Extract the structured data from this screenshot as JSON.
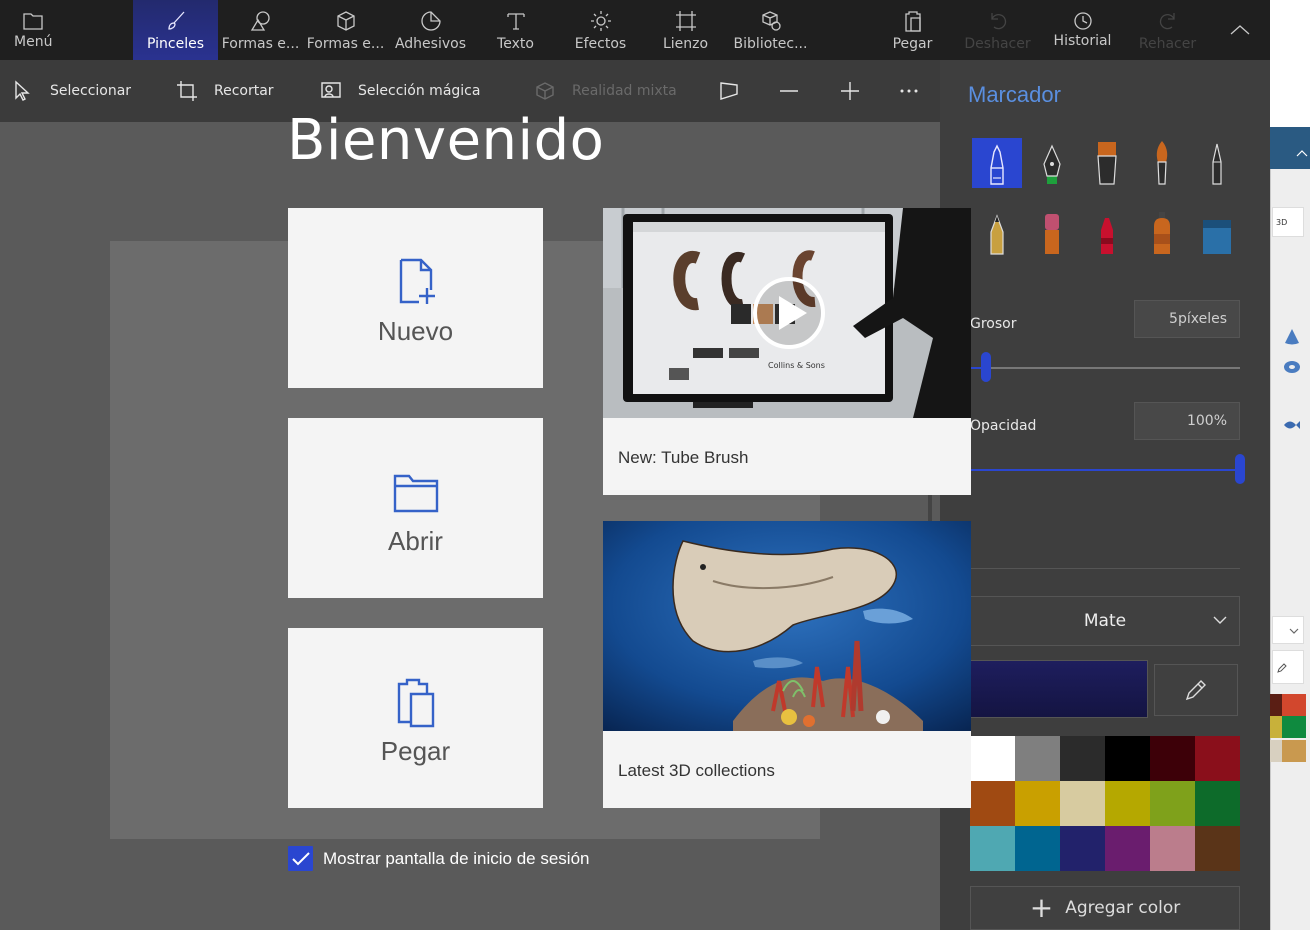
{
  "ribbon": {
    "menu": "Menú",
    "brushes": "Pinceles",
    "shapes2d": "Formas e...",
    "shapes3d": "Formas e...",
    "stickers": "Adhesivos",
    "text": "Texto",
    "effects": "Efectos",
    "canvas": "Lienzo",
    "library": "Bibliotec...",
    "paste": "Pegar",
    "undo": "Deshacer",
    "history": "Historial",
    "redo": "Rehacer"
  },
  "toolbar": {
    "select": "Seleccionar",
    "crop": "Recortar",
    "magic_select": "Selección mágica",
    "mixed_reality": "Realidad mixta"
  },
  "welcome": {
    "title": "Bienvenido",
    "new_label": "Nuevo",
    "open_label": "Abrir",
    "paste_label": "Pegar",
    "card1_label": "New: Tube Brush",
    "card2_label": "Latest 3D collections",
    "card1_screen_brand": "Collins & Sons",
    "show_start_label": "Mostrar pantalla de inicio de sesión"
  },
  "panel": {
    "title": "Marcador",
    "thickness_label": "Grosor",
    "thickness_value": "5píxeles",
    "thickness_fraction": 0.06,
    "opacity_label": "Opacidad",
    "opacity_value": "100%",
    "opacity_fraction": 1.0,
    "finish_label": "Mate",
    "add_color_label": "Agregar color",
    "current_color": "#1e1e5e",
    "palette": [
      "#ffffff",
      "#7f7f7f",
      "#2b2b2b",
      "#000000",
      "#3d0008",
      "#8a0f1b",
      "#a04a12",
      "#c9a000",
      "#d7cba0",
      "#b5a800",
      "#7fa11b",
      "#0d6b2a",
      "#4fa8b2",
      "#006590",
      "#22226b",
      "#6a1d6e",
      "#bb7d8c",
      "#5a3418"
    ]
  },
  "strip": {
    "label_3d": "3D",
    "swatches": [
      "#5a1e14",
      "#d2472d",
      "#c8b13a",
      "#0f8a3f",
      "#d8d0c0",
      "#c9994f"
    ]
  }
}
